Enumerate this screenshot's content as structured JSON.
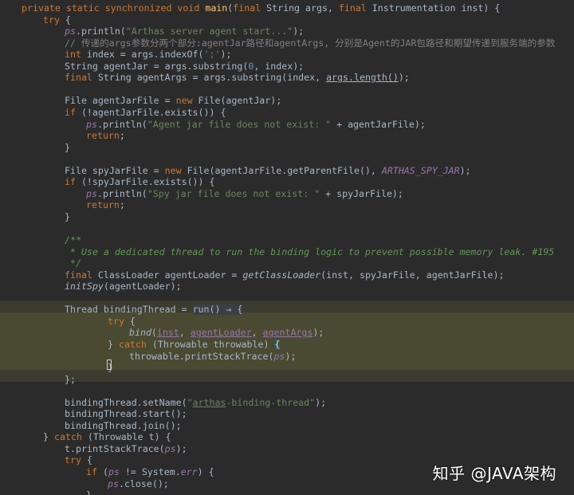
{
  "colors": {
    "keyword": "#cc7832",
    "string": "#6a8759",
    "comment": "#808080",
    "doc": "#629755",
    "field": "#9876aa",
    "method": "#ffc66d",
    "number": "#6897bb",
    "text": "#a9b7c6",
    "param": "#d0d0ff"
  },
  "code": {
    "lines": [
      {
        "indent": 1,
        "tokens": [
          [
            "private static synchronized void ",
            "k"
          ],
          [
            "main",
            "m"
          ],
          [
            "(",
            "t"
          ],
          [
            "final ",
            "k"
          ],
          [
            "String args, ",
            "t"
          ],
          [
            "final ",
            "k"
          ],
          [
            "Instrumentation inst) {",
            "t"
          ]
        ]
      },
      {
        "indent": 2,
        "tokens": [
          [
            "try ",
            "k"
          ],
          [
            "{",
            "t"
          ]
        ]
      },
      {
        "indent": 3,
        "tokens": [
          [
            "ps",
            "fi"
          ],
          [
            ".println(",
            "t"
          ],
          [
            "\"Arthas server agent start...\"",
            "s"
          ],
          [
            ");",
            "t"
          ]
        ]
      },
      {
        "indent": 3,
        "tokens": [
          [
            "// 传递的args参数分两个部分:agentJar路径和agentArgs, 分别是Agent的JAR包路径和期望传递到服务端的参数",
            "c"
          ]
        ]
      },
      {
        "indent": 3,
        "tokens": [
          [
            "int ",
            "k"
          ],
          [
            "index = args.indexOf(",
            "t"
          ],
          [
            "';'",
            "s"
          ],
          [
            ");",
            "t"
          ]
        ]
      },
      {
        "indent": 3,
        "tokens": [
          [
            "String agentJar = args.substring(",
            "t"
          ],
          [
            "0",
            "n"
          ],
          [
            ", index);",
            "t"
          ]
        ]
      },
      {
        "indent": 3,
        "tokens": [
          [
            "final ",
            "k"
          ],
          [
            "String agentArgs = args.substring(index, ",
            "t"
          ],
          [
            "args.length()",
            "u"
          ],
          [
            ");",
            "t"
          ]
        ]
      },
      {
        "indent": 0,
        "tokens": []
      },
      {
        "indent": 3,
        "tokens": [
          [
            "File agentJarFile = ",
            "t"
          ],
          [
            "new ",
            "k"
          ],
          [
            "File(agentJar);",
            "t"
          ]
        ]
      },
      {
        "indent": 3,
        "tokens": [
          [
            "if ",
            "k"
          ],
          [
            "(!agentJarFile.exists()) {",
            "t"
          ]
        ]
      },
      {
        "indent": 4,
        "tokens": [
          [
            "ps",
            "fi"
          ],
          [
            ".println(",
            "t"
          ],
          [
            "\"Agent jar file does not exist: \"",
            "s"
          ],
          [
            " + agentJarFile);",
            "t"
          ]
        ]
      },
      {
        "indent": 4,
        "tokens": [
          [
            "return",
            "k"
          ],
          [
            ";",
            "t"
          ]
        ]
      },
      {
        "indent": 3,
        "tokens": [
          [
            "}",
            "t"
          ]
        ]
      },
      {
        "indent": 0,
        "tokens": []
      },
      {
        "indent": 3,
        "tokens": [
          [
            "File spyJarFile = ",
            "t"
          ],
          [
            "new ",
            "k"
          ],
          [
            "File(agentJarFile.getParentFile(), ",
            "t"
          ],
          [
            "ARTHAS_SPY_JAR",
            "fi"
          ],
          [
            ");",
            "t"
          ]
        ]
      },
      {
        "indent": 3,
        "tokens": [
          [
            "if ",
            "k"
          ],
          [
            "(!spyJarFile.exists()) {",
            "t"
          ]
        ]
      },
      {
        "indent": 4,
        "tokens": [
          [
            "ps",
            "fi"
          ],
          [
            ".println(",
            "t"
          ],
          [
            "\"Spy jar file does not exist: \"",
            "s"
          ],
          [
            " + spyJarFile);",
            "t"
          ]
        ]
      },
      {
        "indent": 4,
        "tokens": [
          [
            "return",
            "k"
          ],
          [
            ";",
            "t"
          ]
        ]
      },
      {
        "indent": 3,
        "tokens": [
          [
            "}",
            "t"
          ]
        ]
      },
      {
        "indent": 0,
        "tokens": []
      },
      {
        "indent": 3,
        "tokens": [
          [
            "/**",
            "d"
          ]
        ]
      },
      {
        "indent": 3,
        "tokens": [
          [
            " * Use a dedicated thread to run the binding logic to prevent possible memory leak. #195",
            "d"
          ]
        ]
      },
      {
        "indent": 3,
        "tokens": [
          [
            " */",
            "d"
          ]
        ]
      },
      {
        "indent": 3,
        "tokens": [
          [
            "final ",
            "k"
          ],
          [
            "ClassLoader agentLoader = ",
            "t"
          ],
          [
            "getClassLoader",
            "i"
          ],
          [
            "(inst, spyJarFile, agentJarFile);",
            "t"
          ]
        ]
      },
      {
        "indent": 3,
        "tokens": [
          [
            "initSpy",
            "i"
          ],
          [
            "(agentLoader);",
            "t"
          ]
        ]
      },
      {
        "indent": 0,
        "tokens": []
      },
      {
        "indent": 3,
        "tokens": [
          [
            "Thread bindingThread = ",
            "t"
          ],
          [
            "run() → {",
            "g"
          ]
        ]
      },
      {
        "indent": 5,
        "tokens": [
          [
            "try ",
            "k"
          ],
          [
            "{",
            "t"
          ]
        ]
      },
      {
        "indent": 6,
        "tokens": [
          [
            "bind",
            "i"
          ],
          [
            "(",
            "t"
          ],
          [
            "inst",
            "pu"
          ],
          [
            ", ",
            "t"
          ],
          [
            "agentLoader",
            "pu"
          ],
          [
            ", ",
            "t"
          ],
          [
            "agentArgs",
            "pu"
          ],
          [
            ");",
            "t"
          ]
        ]
      },
      {
        "indent": 5,
        "tokens": [
          [
            "} ",
            "t"
          ],
          [
            "catch ",
            "k"
          ],
          [
            "(Throwable throwable) ",
            "t"
          ],
          [
            "{",
            "b"
          ]
        ]
      },
      {
        "indent": 6,
        "tokens": [
          [
            "throwable.printStackTrace(",
            "t"
          ],
          [
            "ps",
            "fi"
          ],
          [
            ");",
            "t"
          ]
        ]
      },
      {
        "indent": 5,
        "tokens": [
          [
            "}",
            "t"
          ]
        ]
      },
      {
        "indent": 3,
        "tokens": [
          [
            "};",
            "t"
          ]
        ]
      },
      {
        "indent": 0,
        "tokens": []
      },
      {
        "indent": 3,
        "tokens": [
          [
            "bindingThread.setName(",
            "t"
          ],
          [
            "\"",
            "s"
          ],
          [
            "arthas",
            "su"
          ],
          [
            "-binding-thread\"",
            "s"
          ],
          [
            ");",
            "t"
          ]
        ]
      },
      {
        "indent": 3,
        "tokens": [
          [
            "bindingThread.start();",
            "t"
          ]
        ]
      },
      {
        "indent": 3,
        "tokens": [
          [
            "bindingThread.join();",
            "t"
          ]
        ]
      },
      {
        "indent": 2,
        "tokens": [
          [
            "} ",
            "t"
          ],
          [
            "catch ",
            "k"
          ],
          [
            "(Throwable t) {",
            "t"
          ]
        ]
      },
      {
        "indent": 3,
        "tokens": [
          [
            "t.printStackTrace(",
            "t"
          ],
          [
            "ps",
            "fi"
          ],
          [
            ");",
            "t"
          ]
        ]
      },
      {
        "indent": 3,
        "tokens": [
          [
            "try ",
            "k"
          ],
          [
            "{",
            "t"
          ]
        ]
      },
      {
        "indent": 4,
        "tokens": [
          [
            "if ",
            "k"
          ],
          [
            "(",
            "t"
          ],
          [
            "ps",
            "fi"
          ],
          [
            " != System.",
            "t"
          ],
          [
            "err",
            "fi"
          ],
          [
            ") {",
            "t"
          ]
        ]
      },
      {
        "indent": 5,
        "tokens": [
          [
            "ps",
            "fi"
          ],
          [
            ".close();",
            "t"
          ]
        ]
      },
      {
        "indent": 4,
        "tokens": [
          [
            "}",
            "t"
          ]
        ]
      }
    ]
  },
  "watermark": {
    "text": "知乎 @JAVA架构"
  }
}
